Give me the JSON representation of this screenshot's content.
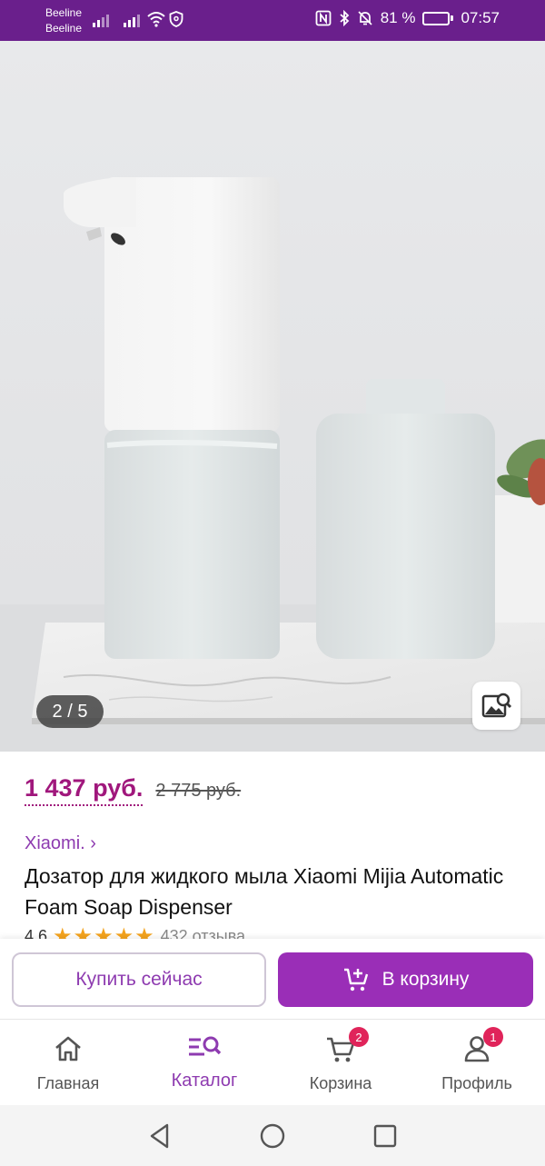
{
  "status_bar": {
    "carrier_1": "Beeline",
    "carrier_2": "Beeline",
    "battery_text": "81 %",
    "battery_level": 0.81,
    "time": "07:57",
    "background_color": "#6a1f8c"
  },
  "gallery": {
    "counter": "2 / 5",
    "current_index": 2,
    "total": 5,
    "image_subject": "white foam soap dispenser with refill bottle on marble tray"
  },
  "product": {
    "price": "1 437 руб.",
    "old_price": "2 775 руб.",
    "brand": "Xiaomi. ›",
    "title": "Дозатор для жидкого мыла Xiaomi Mijia Automatic Foam Soap Dispenser",
    "rating_value": "4.6",
    "rating_stars": "★★★★★",
    "reviews": "432 отзыва"
  },
  "actions": {
    "buy_now": "Купить сейчас",
    "add_to_cart": "В корзину"
  },
  "bottom_nav": {
    "items": [
      {
        "label": "Главная",
        "icon": "home-icon"
      },
      {
        "label": "Каталог",
        "icon": "catalog-search-icon"
      },
      {
        "label": "Корзина",
        "icon": "cart-icon",
        "badge": "2"
      },
      {
        "label": "Профиль",
        "icon": "profile-icon",
        "badge": "1"
      }
    ],
    "active": "Каталог"
  },
  "colors": {
    "accent": "#9a2eb7",
    "price": "#a0177c",
    "badge": "#e0245a"
  }
}
